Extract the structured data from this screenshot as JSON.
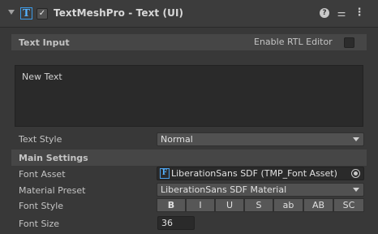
{
  "header": {
    "title": "TextMeshPro - Text (UI)",
    "enabled": true,
    "help_icon": "help-icon",
    "presets_icon": "presets-icon",
    "menu_icon": "kebab-menu-icon"
  },
  "text_input": {
    "section_label": "Text Input",
    "rtl_label": "Enable RTL Editor",
    "rtl_enabled": false,
    "text": "New Text"
  },
  "text_style": {
    "label": "Text Style",
    "value": "Normal"
  },
  "main_settings": {
    "section_label": "Main Settings",
    "font_asset": {
      "label": "Font Asset",
      "value": "LiberationSans SDF (TMP_Font Asset)"
    },
    "material_preset": {
      "label": "Material Preset",
      "value": "LiberationSans SDF Material"
    },
    "font_style": {
      "label": "Font Style",
      "buttons": [
        "B",
        "I",
        "U",
        "S",
        "ab",
        "AB",
        "SC"
      ]
    },
    "font_size": {
      "label": "Font Size",
      "value": "36"
    }
  },
  "colors": {
    "background": "#383838",
    "section": "#464646",
    "field": "#2a2a2a",
    "accent": "#56b3ff"
  }
}
